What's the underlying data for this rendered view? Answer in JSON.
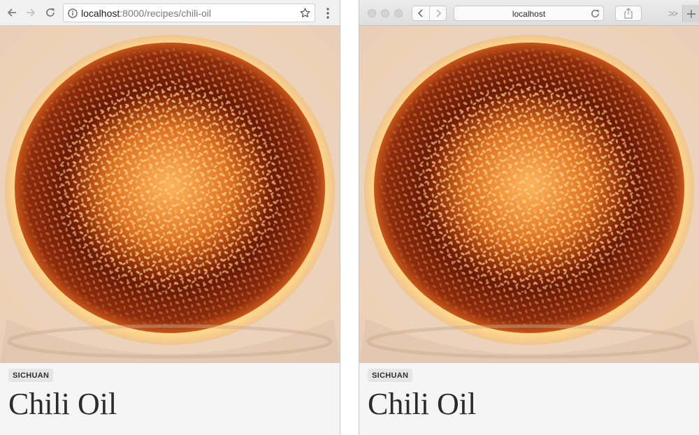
{
  "chrome": {
    "url_host": "localhost",
    "url_path": ":8000/recipes/chili-oil",
    "icons": {
      "back": "arrow-left-icon",
      "forward": "arrow-right-icon",
      "reload": "reload-icon",
      "info": "info-icon",
      "bookmark": "star-icon",
      "menu": "kebab-menu-icon"
    }
  },
  "safari": {
    "address_text": "localhost",
    "overflow_glyph": ">>",
    "new_tab_glyph": "+",
    "icons": {
      "back": "chevron-left-icon",
      "forward": "chevron-right-icon",
      "reload": "reload-icon",
      "share": "share-icon",
      "new_tab": "plus-icon"
    }
  },
  "page": {
    "hero_image": "chili-oil-bowl-photo",
    "tag": "SICHUAN",
    "title": "Chili Oil"
  },
  "colors": {
    "page_background": "#f5f5f5",
    "tag_background": "#e6e6e6",
    "oil_dark": "#5a1608",
    "oil_mid": "#a8350e",
    "sesame": "#f3b76b"
  }
}
